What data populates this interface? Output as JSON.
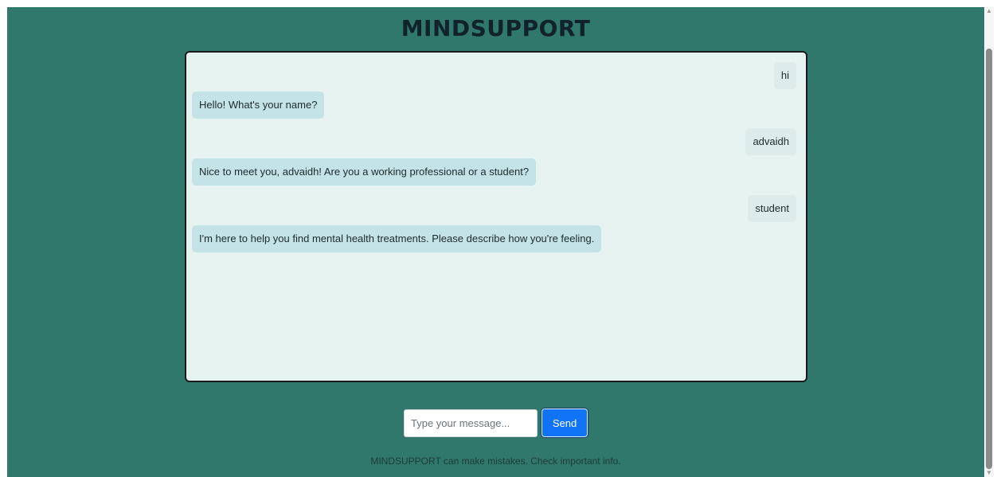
{
  "app": {
    "title": "MINDSUPPORT"
  },
  "messages": [
    {
      "sender": "user",
      "text": "hi"
    },
    {
      "sender": "bot",
      "text": "Hello! What's your name?"
    },
    {
      "sender": "user",
      "text": "advaidh"
    },
    {
      "sender": "bot",
      "text": "Nice to meet you, advaidh! Are you a working professional or a student?"
    },
    {
      "sender": "user",
      "text": "student"
    },
    {
      "sender": "bot",
      "text": "I'm here to help you find mental health treatments. Please describe how you're feeling."
    }
  ],
  "composer": {
    "placeholder": "Type your message...",
    "value": "",
    "send_label": "Send"
  },
  "footer": {
    "disclaimer": "MINDSUPPORT can make mistakes. Check important info."
  },
  "scrollbar": {
    "up_icon": "▲",
    "down_icon": "▼"
  },
  "colors": {
    "background": "#2f786b",
    "chat_background": "#e6f3f1",
    "bot_bubble": "#c4e3e7",
    "user_bubble": "#ddecea",
    "send_button": "#1174f7"
  }
}
